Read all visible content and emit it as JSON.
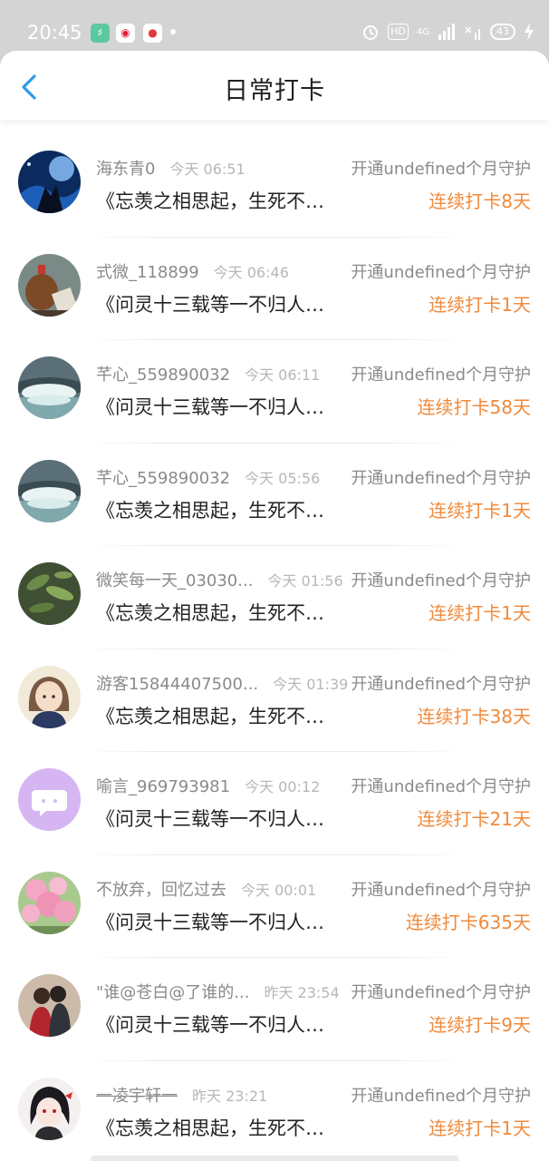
{
  "status_bar": {
    "time": "20:45",
    "network": "4G",
    "hd": "HD",
    "battery": "43",
    "icons": [
      "app-icon",
      "weibo-icon",
      "map-pin-icon",
      "alarm-icon",
      "signal-icon",
      "wifi-off-icon",
      "charging-icon"
    ]
  },
  "header": {
    "title": "日常打卡",
    "back_icon": "chevron-left-icon",
    "accent_color": "#2f9bea"
  },
  "streak_color": "#f08a3c",
  "items": [
    {
      "name": "海东青0",
      "time": "今天 06:51",
      "guard": "开通undefined个月守护",
      "title": "《忘羡之相思起，生死不…",
      "streak": "连续打卡8天",
      "avatar": "night-sky-avatar"
    },
    {
      "name": "式微_118899",
      "time": "今天 06:46",
      "guard": "开通undefined个月守护",
      "title": "《问灵十三载等一不归人…",
      "streak": "连续打卡1天",
      "avatar": "teapot-avatar"
    },
    {
      "name": "芊心_559890032",
      "time": "今天 06:11",
      "guard": "开通undefined个月守护",
      "title": "《问灵十三载等一不归人…",
      "streak": "连续打卡58天",
      "avatar": "waterfall-avatar"
    },
    {
      "name": "芊心_559890032",
      "time": "今天 05:56",
      "guard": "开通undefined个月守护",
      "title": "《忘羡之相思起，生死不…",
      "streak": "连续打卡1天",
      "avatar": "waterfall-avatar"
    },
    {
      "name": "微笑每一天_03030...",
      "time": "今天 01:56",
      "guard": "开通undefined个月守护",
      "title": "《忘羡之相思起，生死不…",
      "streak": "连续打卡1天",
      "avatar": "leaves-avatar"
    },
    {
      "name": "游客15844407500...",
      "time": "今天 01:39",
      "guard": "开通undefined个月守护",
      "title": "《忘羡之相思起，生死不…",
      "streak": "连续打卡38天",
      "avatar": "anime-girl-avatar"
    },
    {
      "name": "喻言_969793981",
      "time": "今天 00:12",
      "guard": "开通undefined个月守护",
      "title": "《问灵十三载等一不归人…",
      "streak": "连续打卡21天",
      "avatar": "default-chat-avatar"
    },
    {
      "name": "不放弃，回忆过去",
      "time": "今天 00:01",
      "guard": "开通undefined个月守护",
      "title": "《问灵十三载等一不归人…",
      "streak": "连续打卡635天",
      "avatar": "blossom-avatar"
    },
    {
      "name": "\"谁@苍白@了谁的...",
      "time": "昨天 23:54",
      "guard": "开通undefined个月守护",
      "title": "《问灵十三载等一不归人…",
      "streak": "连续打卡9天",
      "avatar": "couple-avatar"
    },
    {
      "name": "一凌宇轩一",
      "time": "昨天 23:21",
      "guard": "开通undefined个月守护",
      "title": "《忘羡之相思起，生死不…",
      "streak": "连续打卡1天",
      "avatar": "anime-boy-avatar"
    }
  ]
}
